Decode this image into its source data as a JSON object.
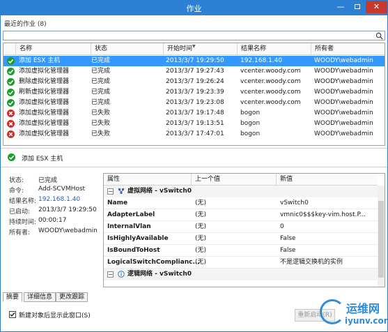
{
  "window": {
    "title": "作业",
    "minimize": "—",
    "close": "✕"
  },
  "recent": {
    "header": "最近的作业 (8)",
    "search_value": ""
  },
  "columns": [
    "名称",
    "状态",
    "开始时间",
    "结果名称",
    "所有者"
  ],
  "jobs": [
    {
      "status": "ok",
      "name": "添加 ESX 主机",
      "state": "已完成",
      "time": "2013/3/7 19:29:50",
      "result": "192.168.1.40",
      "owner": "WOODY\\webadmin",
      "selected": true
    },
    {
      "status": "ok",
      "name": "添加虚拟化管理器",
      "state": "已完成",
      "time": "2013/3/7 19:27:43",
      "result": "vcenter.woody.com",
      "owner": "WOODY\\webadmin"
    },
    {
      "status": "ok",
      "name": "删除虚拟化管理器",
      "state": "已完成",
      "time": "2013/3/7 19:26:24",
      "result": "vcenter.woody.com",
      "owner": "WOODY\\webadmin"
    },
    {
      "status": "ok",
      "name": "刷新虚拟化管理器",
      "state": "已完成",
      "time": "2013/3/7 19:23:39",
      "result": "vcenter.woody.com",
      "owner": "WOODY\\webadmin"
    },
    {
      "status": "ok",
      "name": "添加虚拟化管理器",
      "state": "已完成",
      "time": "2013/3/7 19:23:08",
      "result": "vcenter.woody.com",
      "owner": "WOODY\\webadmin"
    },
    {
      "status": "fail",
      "name": "添加虚拟化管理器",
      "state": "已失败",
      "time": "2013/3/7 19:17:48",
      "result": "bogon",
      "owner": "WOODY\\webadmin"
    },
    {
      "status": "fail",
      "name": "添加虚拟化管理器",
      "state": "已失败",
      "time": "2013/3/7 19:13:51",
      "result": "bogon",
      "owner": "WOODY\\webadmin"
    },
    {
      "status": "fail",
      "name": "添加虚拟化管理器",
      "state": "已失败",
      "time": "2013/3/7 17:47:01",
      "result": "bogon",
      "owner": "WOODY\\webadmin"
    }
  ],
  "detail": {
    "title": "添加 ESX 主机",
    "status_label": "状态:",
    "status_value": "已完成",
    "command_label": "命令:",
    "command_value": "Add-SCVMHost",
    "result_label": "结果名称:",
    "result_value": "192.168.1.40",
    "started_label": "已启动:",
    "started_value": "2013/3/7 19:29:50",
    "duration_label": "持续时间:",
    "duration_value": "00:00:17",
    "owner_label": "所有者:",
    "owner_value": "WOODY\\webadmin"
  },
  "props": {
    "columns": [
      "属性",
      "上一个值",
      "新值"
    ],
    "group1": "虚拟网络 - vSwitch0",
    "rows": [
      {
        "k": "Name",
        "o": "(无)",
        "n": "vSwitch0"
      },
      {
        "k": "AdapterLabel",
        "o": "(无)",
        "n": "vmnic0$$$key-vim.host.P..."
      },
      {
        "k": "InternalVlan",
        "o": "(无)",
        "n": "0"
      },
      {
        "k": "IsHighlyAvailable",
        "o": "(无)",
        "n": "False"
      },
      {
        "k": "IsBoundToHost",
        "o": "(无)",
        "n": "False"
      },
      {
        "k": "LogicalSwitchComplianc...",
        "o": "(无)",
        "n": "不是逻辑交换机的实例"
      }
    ],
    "group2": "逻辑网络 - vSwitch0"
  },
  "tabs": [
    "摘要",
    "详细信息",
    "更改跟踪"
  ],
  "footer": {
    "checkbox_label": "新建对象后显示此窗口(S)",
    "checkbox_checked": true,
    "restart_label": "重新启动(R)"
  },
  "watermark": {
    "line1": "运维网",
    "line2": "iyunv.com"
  },
  "colors": {
    "titlebar": "#2c81d5",
    "selected_row": "#3399ff",
    "ok_icon": "#1b9d2d",
    "fail_icon": "#d42a2a"
  }
}
